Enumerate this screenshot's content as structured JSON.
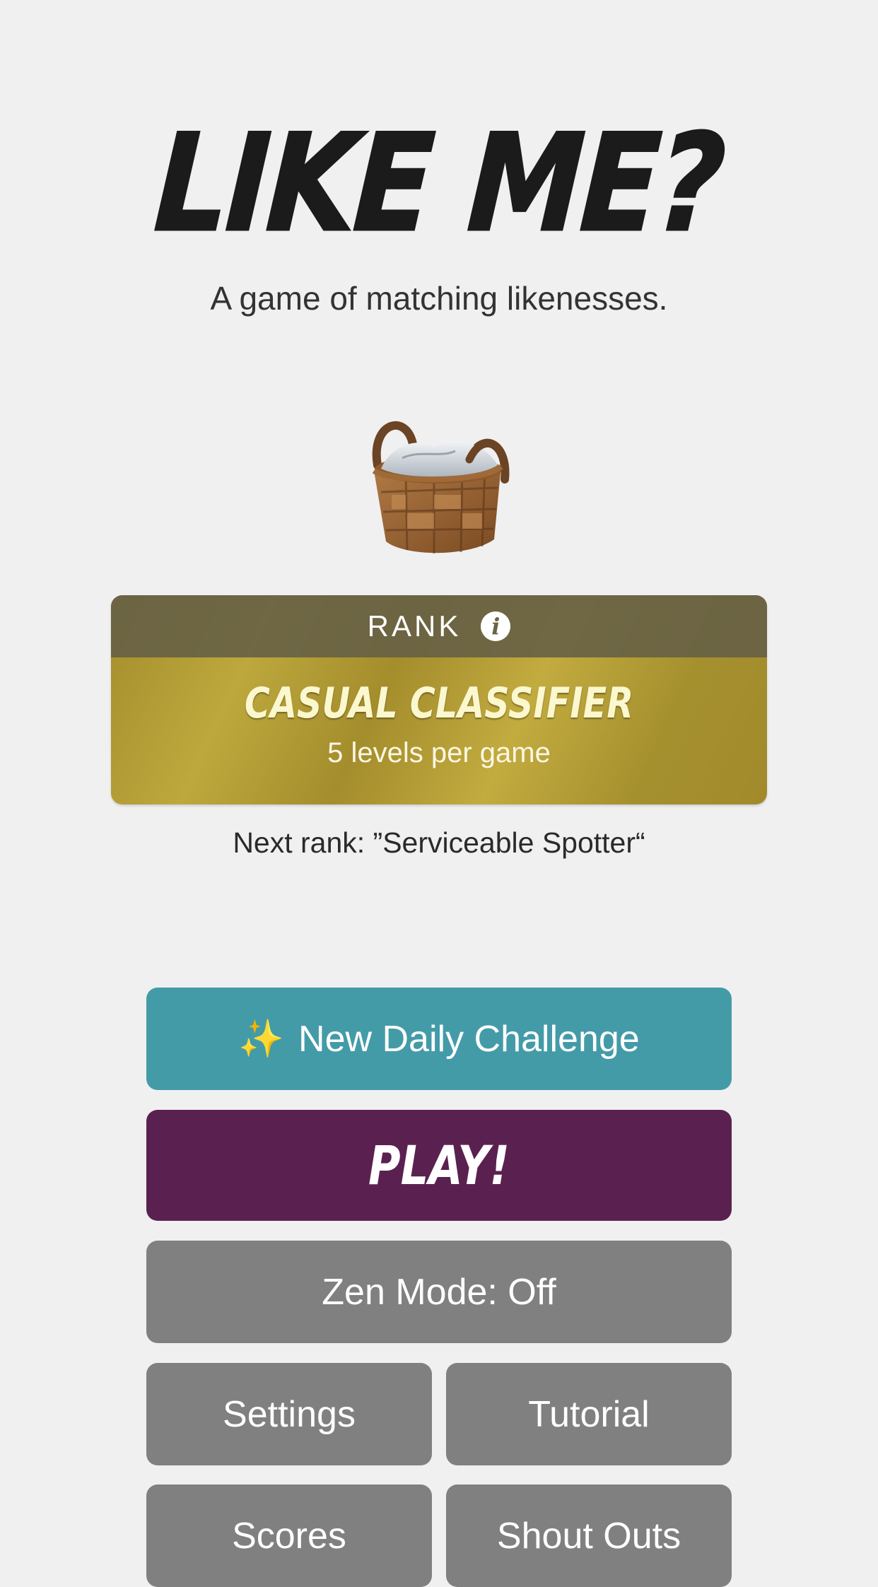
{
  "header": {
    "title": "LIKE ME?",
    "subtitle": "A game of matching likenesses."
  },
  "mascot": {
    "icon": "basket-icon"
  },
  "rank": {
    "label": "RANK",
    "info_icon": "i",
    "title": "CASUAL CLASSIFIER",
    "levels": "5 levels per game",
    "next_rank": "Next rank: ”Serviceable Spotter“"
  },
  "buttons": {
    "daily_icon": "✨",
    "daily_label": "New Daily Challenge",
    "play_label": "PLAY!",
    "zen_label": "Zen Mode: Off",
    "settings_label": "Settings",
    "tutorial_label": "Tutorial",
    "scores_label": "Scores",
    "shout_outs_label": "Shout Outs"
  },
  "colors": {
    "background": "#f0f0f1",
    "daily": "#449ba8",
    "play": "#5a2150",
    "gray": "#808080",
    "rank_gold": "#b49e36",
    "rank_header": "#6a6446"
  }
}
